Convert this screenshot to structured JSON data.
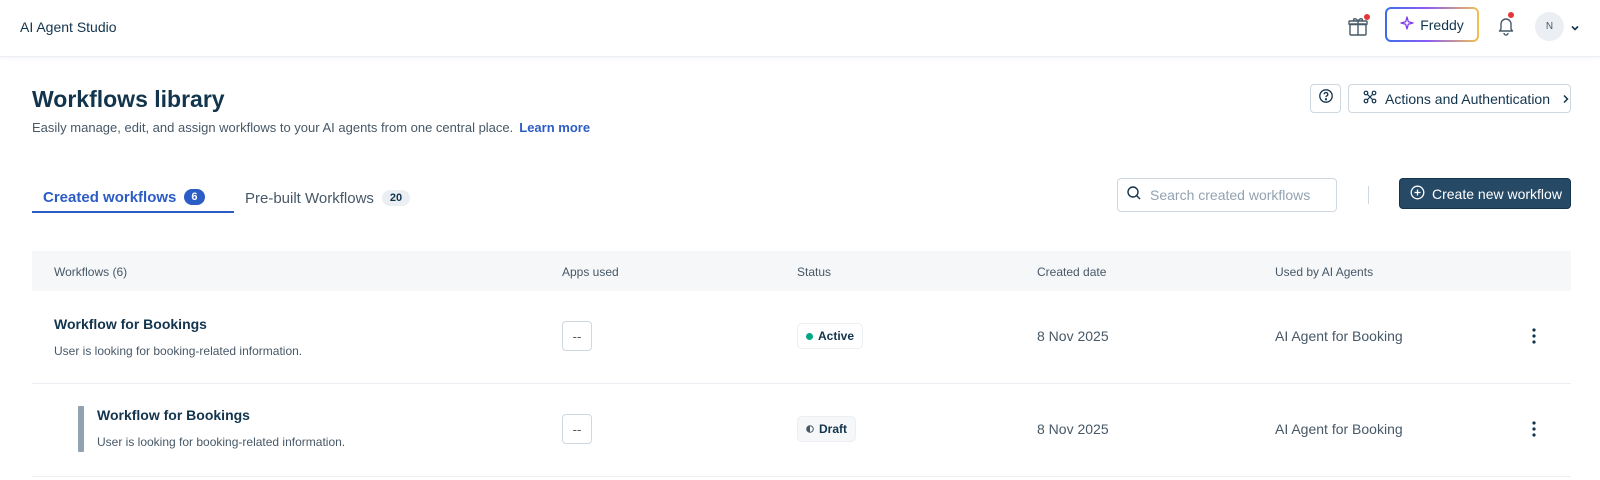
{
  "header": {
    "app_title": "AI Agent Studio",
    "freddy_label": "Freddy",
    "avatar_initial": "N",
    "icons": [
      "gift-icon",
      "sparkle-icon",
      "bell-icon",
      "chevron-down-icon"
    ],
    "notification_dot_color": "#e43538"
  },
  "page": {
    "title": "Workflows library",
    "subtitle": "Easily manage, edit, and assign workflows to your AI agents from one central place.",
    "learn_more": "Learn more",
    "actions_button": "Actions and Authentication"
  },
  "tabs": [
    {
      "label": "Created workflows",
      "count": "6",
      "active": true
    },
    {
      "label": "Pre-built Workflows",
      "count": "20",
      "active": false
    }
  ],
  "search": {
    "placeholder": "Search created workflows"
  },
  "create_button": "Create new workflow",
  "table": {
    "columns": [
      "Workflows (6)",
      "Apps used",
      "Status",
      "Created date",
      "Used by AI Agents"
    ],
    "rows": [
      {
        "name": "Workflow for Bookings",
        "description": "User is looking for booking-related information.",
        "apps": "--",
        "status": "Active",
        "created": "8 Nov 2025",
        "agent": "AI Agent for Booking",
        "nested": false
      },
      {
        "name": "Workflow for Bookings",
        "description": "User is looking for booking-related information.",
        "apps": "--",
        "status": "Draft",
        "created": "8 Nov 2025",
        "agent": "AI Agent for Booking",
        "nested": true
      }
    ]
  },
  "colors": {
    "primary_blue": "#2c5cc5",
    "dark_button": "#264966",
    "active_status": "#00a886",
    "text_dark": "#12344d"
  }
}
